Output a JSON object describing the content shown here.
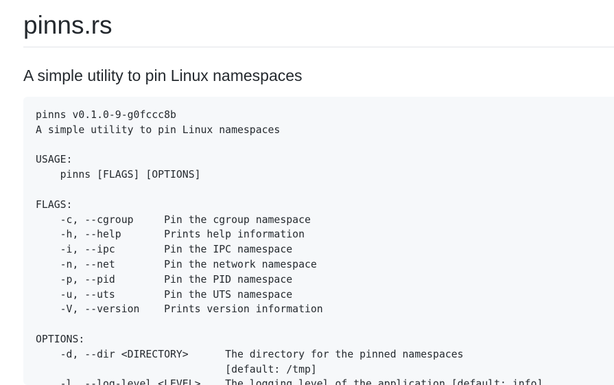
{
  "page": {
    "title": "pinns.rs",
    "subtitle": "A simple utility to pin Linux namespaces"
  },
  "code": {
    "lines": [
      "pinns v0.1.0-9-g0fccc8b",
      "A simple utility to pin Linux namespaces",
      "",
      "USAGE:",
      "    pinns [FLAGS] [OPTIONS]",
      "",
      "FLAGS:",
      "    -c, --cgroup     Pin the cgroup namespace",
      "    -h, --help       Prints help information",
      "    -i, --ipc        Pin the IPC namespace",
      "    -n, --net        Pin the network namespace",
      "    -p, --pid        Pin the PID namespace",
      "    -u, --uts        Pin the UTS namespace",
      "    -V, --version    Prints version information",
      "",
      "OPTIONS:",
      "    -d, --dir <DIRECTORY>      The directory for the pinned namespaces",
      "                               [default: /tmp]",
      "    -l, --log-level <LEVEL>    The logging level of the application [default: info]"
    ]
  }
}
